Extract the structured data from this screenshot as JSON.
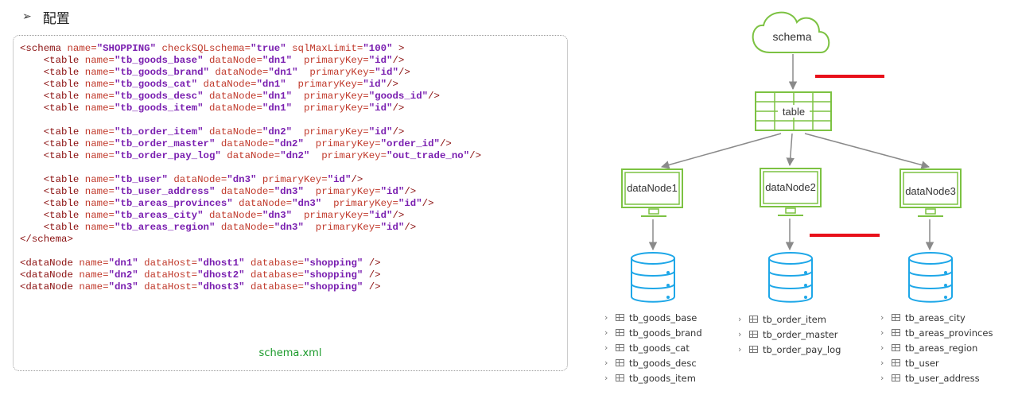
{
  "heading": {
    "bullet": "➢",
    "title": "配置"
  },
  "code": {
    "lines": [
      [
        {
          "c": "tag",
          "t": "<schema "
        },
        {
          "c": "attr",
          "t": "name="
        },
        {
          "c": "val",
          "t": "\"SHOPPING\""
        },
        {
          "c": "attr",
          "t": " checkSQLschema="
        },
        {
          "c": "val",
          "t": "\"true\""
        },
        {
          "c": "attr",
          "t": " sqlMaxLimit="
        },
        {
          "c": "val",
          "t": "\"100\""
        },
        {
          "c": "tag",
          "t": " >"
        }
      ],
      [
        {
          "c": "tag",
          "t": "    <table "
        },
        {
          "c": "attr",
          "t": "name="
        },
        {
          "c": "val",
          "t": "\"tb_goods_base\""
        },
        {
          "c": "attr",
          "t": " dataNode="
        },
        {
          "c": "val",
          "t": "\"dn1\""
        },
        {
          "c": "attr",
          "t": "  primaryKey="
        },
        {
          "c": "val",
          "t": "\"id\""
        },
        {
          "c": "tag",
          "t": "/>"
        }
      ],
      [
        {
          "c": "tag",
          "t": "    <table "
        },
        {
          "c": "attr",
          "t": "name="
        },
        {
          "c": "val",
          "t": "\"tb_goods_brand\""
        },
        {
          "c": "attr",
          "t": " dataNode="
        },
        {
          "c": "val",
          "t": "\"dn1\""
        },
        {
          "c": "attr",
          "t": "  primaryKey="
        },
        {
          "c": "val",
          "t": "\"id\""
        },
        {
          "c": "tag",
          "t": "/>"
        }
      ],
      [
        {
          "c": "tag",
          "t": "    <table "
        },
        {
          "c": "attr",
          "t": "name="
        },
        {
          "c": "val",
          "t": "\"tb_goods_cat\""
        },
        {
          "c": "attr",
          "t": " dataNode="
        },
        {
          "c": "val",
          "t": "\"dn1\""
        },
        {
          "c": "attr",
          "t": "  primaryKey="
        },
        {
          "c": "val",
          "t": "\"id\""
        },
        {
          "c": "tag",
          "t": "/>"
        }
      ],
      [
        {
          "c": "tag",
          "t": "    <table "
        },
        {
          "c": "attr",
          "t": "name="
        },
        {
          "c": "val",
          "t": "\"tb_goods_desc\""
        },
        {
          "c": "attr",
          "t": " dataNode="
        },
        {
          "c": "val",
          "t": "\"dn1\""
        },
        {
          "c": "attr",
          "t": "  primaryKey="
        },
        {
          "c": "val",
          "t": "\"goods_id\""
        },
        {
          "c": "tag",
          "t": "/>"
        }
      ],
      [
        {
          "c": "tag",
          "t": "    <table "
        },
        {
          "c": "attr",
          "t": "name="
        },
        {
          "c": "val",
          "t": "\"tb_goods_item\""
        },
        {
          "c": "attr",
          "t": " dataNode="
        },
        {
          "c": "val",
          "t": "\"dn1\""
        },
        {
          "c": "attr",
          "t": "  primaryKey="
        },
        {
          "c": "val",
          "t": "\"id\""
        },
        {
          "c": "tag",
          "t": "/>"
        }
      ],
      [],
      [
        {
          "c": "tag",
          "t": "    <table "
        },
        {
          "c": "attr",
          "t": "name="
        },
        {
          "c": "val",
          "t": "\"tb_order_item\""
        },
        {
          "c": "attr",
          "t": " dataNode="
        },
        {
          "c": "val",
          "t": "\"dn2\""
        },
        {
          "c": "attr",
          "t": "  primaryKey="
        },
        {
          "c": "val",
          "t": "\"id\""
        },
        {
          "c": "tag",
          "t": "/>"
        }
      ],
      [
        {
          "c": "tag",
          "t": "    <table "
        },
        {
          "c": "attr",
          "t": "name="
        },
        {
          "c": "val",
          "t": "\"tb_order_master\""
        },
        {
          "c": "attr",
          "t": " dataNode="
        },
        {
          "c": "val",
          "t": "\"dn2\""
        },
        {
          "c": "attr",
          "t": "  primaryKey="
        },
        {
          "c": "val",
          "t": "\"order_id\""
        },
        {
          "c": "tag",
          "t": "/>"
        }
      ],
      [
        {
          "c": "tag",
          "t": "    <table "
        },
        {
          "c": "attr",
          "t": "name="
        },
        {
          "c": "val",
          "t": "\"tb_order_pay_log\""
        },
        {
          "c": "attr",
          "t": " dataNode="
        },
        {
          "c": "val",
          "t": "\"dn2\""
        },
        {
          "c": "attr",
          "t": "  primaryKey="
        },
        {
          "c": "val",
          "t": "\"out_trade_no\""
        },
        {
          "c": "tag",
          "t": "/>"
        }
      ],
      [],
      [
        {
          "c": "tag",
          "t": "    <table "
        },
        {
          "c": "attr",
          "t": "name="
        },
        {
          "c": "val",
          "t": "\"tb_user\""
        },
        {
          "c": "attr",
          "t": " dataNode="
        },
        {
          "c": "val",
          "t": "\"dn3\""
        },
        {
          "c": "attr",
          "t": " primaryKey="
        },
        {
          "c": "val",
          "t": "\"id\""
        },
        {
          "c": "tag",
          "t": "/>"
        }
      ],
      [
        {
          "c": "tag",
          "t": "    <table "
        },
        {
          "c": "attr",
          "t": "name="
        },
        {
          "c": "val",
          "t": "\"tb_user_address\""
        },
        {
          "c": "attr",
          "t": " dataNode="
        },
        {
          "c": "val",
          "t": "\"dn3\""
        },
        {
          "c": "attr",
          "t": "  primaryKey="
        },
        {
          "c": "val",
          "t": "\"id\""
        },
        {
          "c": "tag",
          "t": "/>"
        }
      ],
      [
        {
          "c": "tag",
          "t": "    <table "
        },
        {
          "c": "attr",
          "t": "name="
        },
        {
          "c": "val",
          "t": "\"tb_areas_provinces\""
        },
        {
          "c": "attr",
          "t": " dataNode="
        },
        {
          "c": "val",
          "t": "\"dn3\""
        },
        {
          "c": "attr",
          "t": "  primaryKey="
        },
        {
          "c": "val",
          "t": "\"id\""
        },
        {
          "c": "tag",
          "t": "/>"
        }
      ],
      [
        {
          "c": "tag",
          "t": "    <table "
        },
        {
          "c": "attr",
          "t": "name="
        },
        {
          "c": "val",
          "t": "\"tb_areas_city\""
        },
        {
          "c": "attr",
          "t": " dataNode="
        },
        {
          "c": "val",
          "t": "\"dn3\""
        },
        {
          "c": "attr",
          "t": "  primaryKey="
        },
        {
          "c": "val",
          "t": "\"id\""
        },
        {
          "c": "tag",
          "t": "/>"
        }
      ],
      [
        {
          "c": "tag",
          "t": "    <table "
        },
        {
          "c": "attr",
          "t": "name="
        },
        {
          "c": "val",
          "t": "\"tb_areas_region\""
        },
        {
          "c": "attr",
          "t": " dataNode="
        },
        {
          "c": "val",
          "t": "\"dn3\""
        },
        {
          "c": "attr",
          "t": "  primaryKey="
        },
        {
          "c": "val",
          "t": "\"id\""
        },
        {
          "c": "tag",
          "t": "/>"
        }
      ],
      [
        {
          "c": "tag",
          "t": "</schema>"
        }
      ],
      [],
      [
        {
          "c": "tag",
          "t": "<dataNode "
        },
        {
          "c": "attr",
          "t": "name="
        },
        {
          "c": "val",
          "t": "\"dn1\""
        },
        {
          "c": "attr",
          "t": " dataHost="
        },
        {
          "c": "val",
          "t": "\"dhost1\""
        },
        {
          "c": "attr",
          "t": " database="
        },
        {
          "c": "val",
          "t": "\"shopping\""
        },
        {
          "c": "tag",
          "t": " />"
        }
      ],
      [
        {
          "c": "tag",
          "t": "<dataNode "
        },
        {
          "c": "attr",
          "t": "name="
        },
        {
          "c": "val",
          "t": "\"dn2\""
        },
        {
          "c": "attr",
          "t": " dataHost="
        },
        {
          "c": "val",
          "t": "\"dhost2\""
        },
        {
          "c": "attr",
          "t": " database="
        },
        {
          "c": "val",
          "t": "\"shopping\""
        },
        {
          "c": "tag",
          "t": " />"
        }
      ],
      [
        {
          "c": "tag",
          "t": "<dataNode "
        },
        {
          "c": "attr",
          "t": "name="
        },
        {
          "c": "val",
          "t": "\"dn3\""
        },
        {
          "c": "attr",
          "t": " dataHost="
        },
        {
          "c": "val",
          "t": "\"dhost3\""
        },
        {
          "c": "attr",
          "t": " database="
        },
        {
          "c": "val",
          "t": "\"shopping\""
        },
        {
          "c": "tag",
          "t": " />"
        }
      ]
    ],
    "caption": "schema.xml"
  },
  "diagram": {
    "schema_label": "schema",
    "table_label": "table",
    "nodes": [
      {
        "label": "dataNode1",
        "tables": [
          "tb_goods_base",
          "tb_goods_brand",
          "tb_goods_cat",
          "tb_goods_desc",
          "tb_goods_item"
        ]
      },
      {
        "label": "dataNode2",
        "tables": [
          "tb_order_item",
          "tb_order_master",
          "tb_order_pay_log"
        ]
      },
      {
        "label": "dataNode3",
        "tables": [
          "tb_areas_city",
          "tb_areas_provinces",
          "tb_areas_region",
          "tb_user",
          "tb_user_address"
        ]
      }
    ],
    "colors": {
      "green": "#7cc242",
      "blue": "#1ea7e8",
      "arrow": "#8a8a8a",
      "highlight": "#e8101a"
    },
    "icons": {
      "chevron": "›"
    }
  }
}
